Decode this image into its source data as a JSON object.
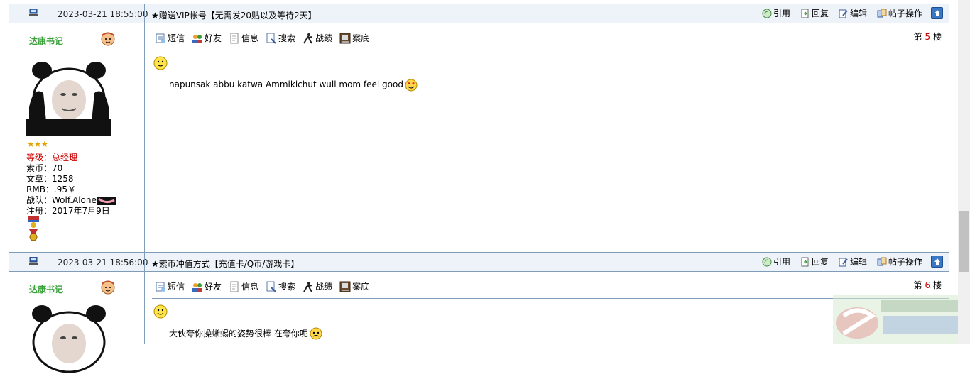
{
  "posts": [
    {
      "time": "2023-03-21 18:55:00",
      "title": "★赠送VIP帐号【无需发20贴以及等待2天】",
      "floor_prefix": "第",
      "floor_num": "5",
      "floor_suffix": "楼",
      "content": "napunsak abbu katwa  Ammikichut wull mom feel good"
    },
    {
      "time": "2023-03-21 18:56:00",
      "title": "★索币冲值方式【充值卡/Q币/游戏卡】",
      "floor_prefix": "第",
      "floor_num": "6",
      "floor_suffix": "楼",
      "content": "大伙夸你操蜥蜴的姿势很棒 在夸你呢"
    }
  ],
  "header_actions": {
    "quote": "引用",
    "reply": "回复",
    "edit": "编辑",
    "manage": "帖子操作"
  },
  "toolbar": {
    "pm": "短信",
    "friend": "好友",
    "info": "信息",
    "search": "搜索",
    "record": "战绩",
    "archive": "案底"
  },
  "user": {
    "name": "达康书记",
    "stars": "★★★",
    "level": "等级：总经理",
    "coins": "索币：70",
    "articles": "文章：1258",
    "rmb": "RMB：.95￥",
    "team": "战队：Wolf.Alone",
    "registered": "注册：2017年7月9日"
  },
  "colors": {
    "border": "#7f9db9",
    "header_bg": "#eef3fa",
    "username": "#3aa13a",
    "level": "#cc0000",
    "floor_num": "#cc0000"
  }
}
